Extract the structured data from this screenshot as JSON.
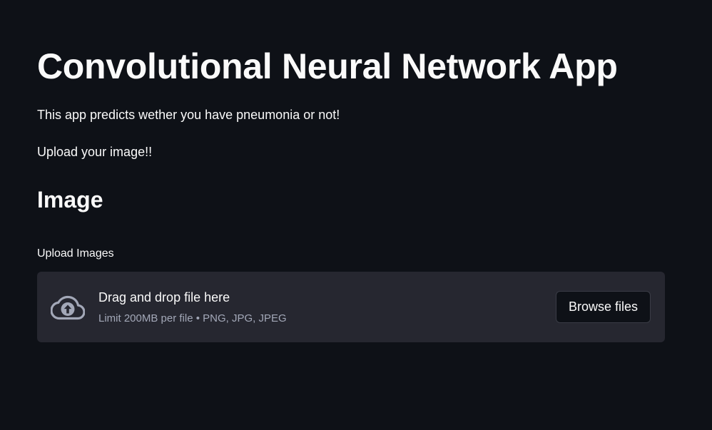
{
  "page": {
    "title": "Convolutional Neural Network App",
    "intro": "This app predicts wether you have pneumonia or not!",
    "upload_prompt": "Upload your image!!",
    "section_heading": "Image"
  },
  "uploader": {
    "label": "Upload Images",
    "dropzone_title": "Drag and drop file here",
    "dropzone_hint": "Limit 200MB per file • PNG, JPG, JPEG",
    "browse_label": "Browse files",
    "icon": "cloud-upload-icon"
  },
  "colors": {
    "background": "#0e1117",
    "dropzone_background": "#262730",
    "text": "#fafafa",
    "muted_text": "#a3a8b8",
    "icon": "#a3a8b8"
  }
}
